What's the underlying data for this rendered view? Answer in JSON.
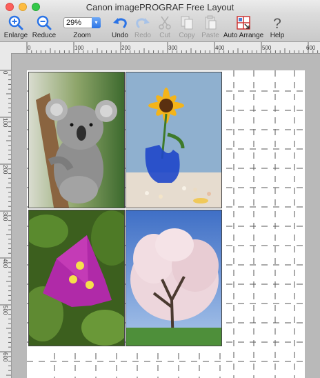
{
  "window": {
    "title": "Canon imagePROGRAF Free Layout"
  },
  "toolbar": {
    "enlarge": {
      "label": "Enlarge",
      "icon": "zoom-in-icon"
    },
    "reduce": {
      "label": "Reduce",
      "icon": "zoom-out-icon"
    },
    "zoom": {
      "label": "Zoom",
      "value": "29%"
    },
    "undo": {
      "label": "Undo",
      "icon": "undo-icon"
    },
    "redo": {
      "label": "Redo",
      "icon": "redo-icon"
    },
    "cut": {
      "label": "Cut",
      "icon": "scissors-icon"
    },
    "copy": {
      "label": "Copy",
      "icon": "copy-icon"
    },
    "paste": {
      "label": "Paste",
      "icon": "paste-icon"
    },
    "auto_arrange": {
      "label": "Auto Arrange",
      "icon": "auto-arrange-icon"
    },
    "help": {
      "label": "Help",
      "icon": "question-icon"
    }
  },
  "ruler": {
    "horizontal": [
      "0",
      "100",
      "200",
      "300",
      "400",
      "500",
      "600"
    ],
    "vertical": [
      "0",
      "100",
      "200",
      "300",
      "400",
      "500",
      "600"
    ]
  },
  "photos": [
    {
      "subject": "koala-photo"
    },
    {
      "subject": "sunflower-vase-photo"
    },
    {
      "subject": "bougainvillea-flower-photo"
    },
    {
      "subject": "cherry-blossom-tree-photo"
    }
  ],
  "colors": {
    "accent": "#2a73e6",
    "canvas": "#b9b9b9",
    "paper": "#ffffff"
  }
}
